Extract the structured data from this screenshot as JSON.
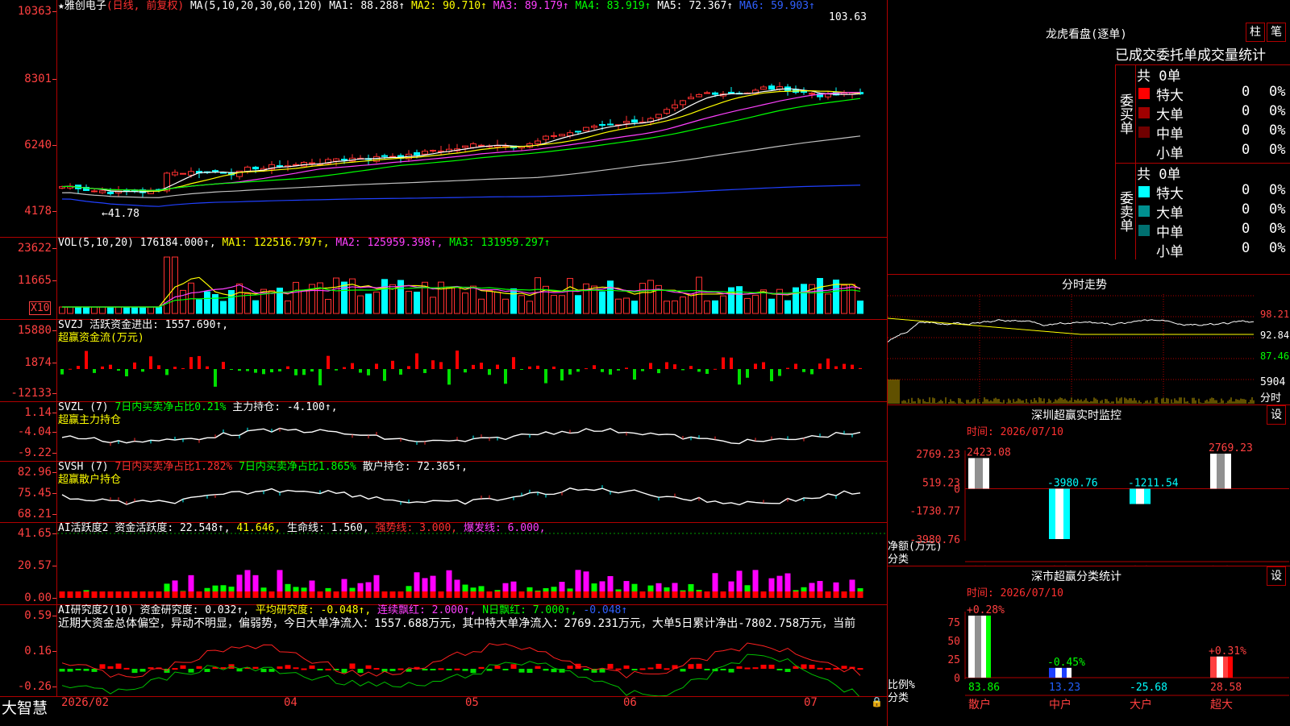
{
  "stock": {
    "star": "★",
    "name": "雅创电子",
    "period": "(日线, 前复权)"
  },
  "main_ma": {
    "label": "MA(5,10,20,30,60,120)",
    "ma1": "MA1: 88.288↑",
    "ma2": "MA2: 90.710↑",
    "ma3": "MA3: 89.179↑",
    "ma4": "MA4: 83.919↑",
    "ma5": "MA5: 72.367↑",
    "ma6": "MA6: 59.903↑"
  },
  "main_axis": [
    "10363",
    "8301",
    "6240",
    "4178"
  ],
  "main_marks": {
    "high": "103.63",
    "low": "←41.78"
  },
  "vol": {
    "label": "VOL(5,10,20)",
    "value": "176184.000↑,",
    "ma1": "MA1: 122516.797↑,",
    "ma2": "MA2: 125959.398↑,",
    "ma3": "MA3: 131959.297↑",
    "axis": [
      "23622",
      "11665"
    ],
    "unit": "X10"
  },
  "svzj": {
    "label": "SVZJ",
    "text": "活跃资金进出: 1557.690↑,",
    "sub": "超赢资金流(万元)",
    "axis": [
      "15880",
      "1874",
      "-12133"
    ]
  },
  "svzl": {
    "label": "SVZL (7)",
    "t1": "7日内买卖净占比0.21%",
    "t2": "主力持仓: -4.100↑,",
    "sub": "超赢主力持仓",
    "axis": [
      "1.14",
      "-4.04",
      "-9.22"
    ]
  },
  "svsh": {
    "label": "SVSH (7)",
    "t1": "7日内买卖净占比1.282%",
    "t2": "7日内买卖净占比1.865%",
    "t3": "散户持仓: 72.365↑,",
    "sub": "超赢散户持仓",
    "axis": [
      "82.96",
      "75.45",
      "68.21"
    ]
  },
  "ai1": {
    "label": "AI活跃度2",
    "t1": "资金活跃度: 22.548↑,",
    "t2": "41.646,",
    "t3": "生命线: 1.560,",
    "t4": "强势线: 3.000,",
    "t5": "爆发线: 6.000,",
    "axis": [
      "41.65",
      "20.57",
      "0.00"
    ]
  },
  "ai2": {
    "label": "AI研究度2(10)",
    "t1": "资金研究度: 0.032↑,",
    "t2": "平均研究度: -0.048↑,",
    "t3": "连续飘红: 2.000↑,",
    "t4": "N日飘红: 7.000↑,",
    "t5": "-0.048↑",
    "desc": "近期大资金总体偏空，异动不明显，偏弱势，今日大单净流入：1557.688万元，其中特大单净流入：2769.231万元，大单5日累计净出-7802.758万元，当前",
    "axis": [
      "0.59",
      "0.16",
      "-0.26"
    ]
  },
  "bottom": {
    "brand": "大智慧",
    "dates": [
      "2026/02",
      "04",
      "05",
      "06",
      "07"
    ]
  },
  "lhb": {
    "title": "龙虎看盘(逐单)",
    "btn1": "柱",
    "btn2": "笔",
    "tabs": "已成交委托单成交量统计",
    "buy": {
      "side": "委买单",
      "total": "共 0单",
      "rows": [
        {
          "label": "特大",
          "n": "0",
          "p": "0%",
          "color": "#ff0000"
        },
        {
          "label": "大单",
          "n": "0",
          "p": "0%",
          "color": "#a00000"
        },
        {
          "label": "中单",
          "n": "0",
          "p": "0%",
          "color": "#700000"
        },
        {
          "label": "小单",
          "n": "0",
          "p": "0%",
          "color": ""
        }
      ]
    },
    "sell": {
      "side": "委卖单",
      "total": "共 0单",
      "rows": [
        {
          "label": "特大",
          "n": "0",
          "p": "0%",
          "color": "#00ffff"
        },
        {
          "label": "大单",
          "n": "0",
          "p": "0%",
          "color": "#009090"
        },
        {
          "label": "中单",
          "n": "0",
          "p": "0%",
          "color": "#007070"
        },
        {
          "label": "小单",
          "n": "0",
          "p": "0%",
          "color": ""
        }
      ]
    }
  },
  "fenshi": {
    "title": "分时走势",
    "prices": [
      "98.21",
      "92.84",
      "87.46"
    ],
    "vol": "5904",
    "unit": "分时"
  },
  "sz": {
    "title": "深圳超赢实时监控",
    "btn": "设",
    "time": "时间: 2026/07/10",
    "axis": [
      "2769.23",
      "519.23",
      "0",
      "-1730.77",
      "-3980.76"
    ],
    "ylabel": "净额(万元)",
    "xlabel": "分类",
    "bars": [
      {
        "cat": "散户",
        "v": 2423.08,
        "label": "2423.08"
      },
      {
        "cat": "中户",
        "v": -3980.76,
        "label": "-3980.76"
      },
      {
        "cat": "大户",
        "v": -1211.54,
        "label": "-1211.54"
      },
      {
        "cat": "超大",
        "v": 2769.23,
        "label": "2769.23"
      }
    ]
  },
  "ssc": {
    "title": "深市超赢分类统计",
    "btn": "设",
    "time": "时间: 2026/07/10",
    "axis": [
      "75",
      "50",
      "25",
      "0"
    ],
    "ylabel": "比例%",
    "xlabel": "分类",
    "bars": [
      {
        "cat": "散户",
        "v": 83.86,
        "pct": "+0.28%",
        "val": "83.86"
      },
      {
        "cat": "中户",
        "v": 13.23,
        "pct": "-0.45%",
        "val": "13.23"
      },
      {
        "cat": "大户",
        "v": 0,
        "pct": "",
        "val": "-25.68"
      },
      {
        "cat": "超大",
        "v": 28.58,
        "pct": "+0.31%",
        "val": "28.58"
      }
    ]
  },
  "colors": {
    "up": "#ff3030",
    "down": "#00ffff",
    "grid": "#b00000"
  }
}
